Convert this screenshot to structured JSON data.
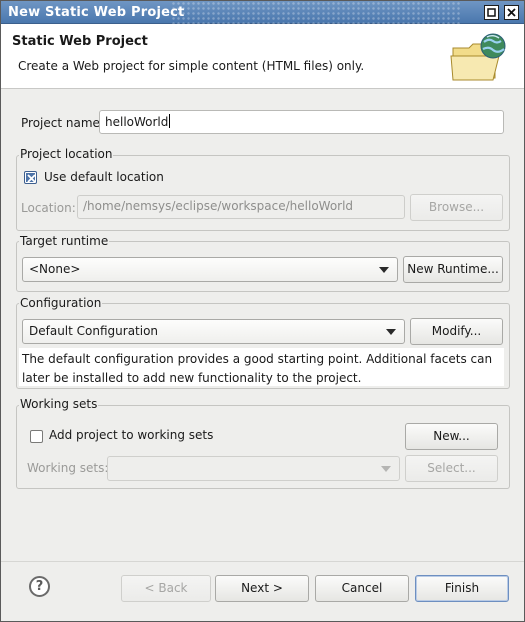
{
  "window": {
    "title": "New Static Web Project"
  },
  "header": {
    "title": "Static Web Project",
    "description": "Create a Web project for simple content (HTML files) only."
  },
  "project": {
    "name_label": "Project name:",
    "name_value": "helloWorld"
  },
  "location": {
    "group_title": "Project location",
    "use_default_label": "Use default location",
    "use_default_checked": true,
    "location_label": "Location:",
    "location_value": "/home/nemsys/eclipse/workspace/helloWorld",
    "browse_label": "Browse..."
  },
  "runtime": {
    "group_title": "Target runtime",
    "selected": "<None>",
    "new_runtime_label": "New Runtime..."
  },
  "configuration": {
    "group_title": "Configuration",
    "selected": "Default Configuration",
    "modify_label": "Modify...",
    "description": "The default configuration provides a good starting point. Additional facets can later be installed to add new functionality to the project."
  },
  "working_sets": {
    "group_title": "Working sets",
    "add_label": "Add project to working sets",
    "add_checked": false,
    "new_label": "New...",
    "sets_label": "Working sets:",
    "select_label": "Select..."
  },
  "footer": {
    "help_symbol": "?",
    "back_label": "< Back",
    "next_label": "Next >",
    "cancel_label": "Cancel",
    "finish_label": "Finish"
  },
  "colors": {
    "titlebar": "#4a77ad",
    "background": "#eeeeec",
    "checkbox_fill": "#4d73a8"
  }
}
